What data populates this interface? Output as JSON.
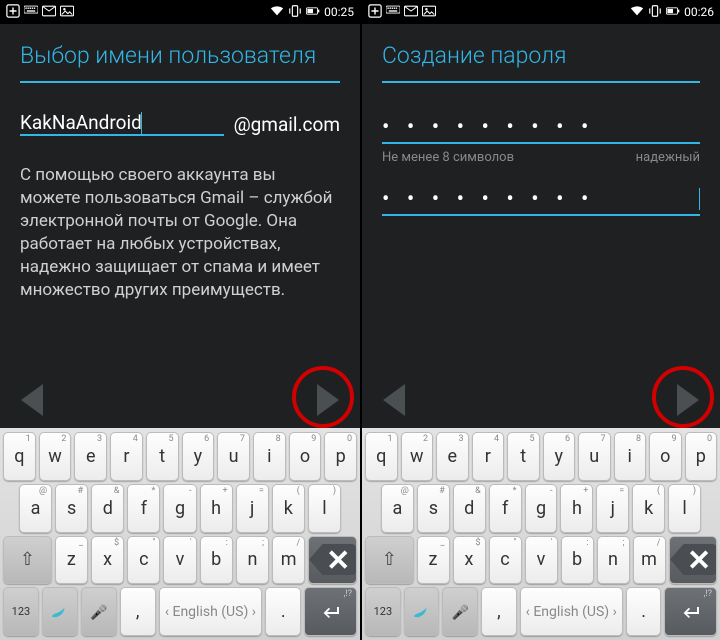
{
  "panes": [
    {
      "status": {
        "time": "00:25"
      },
      "title": "Выбор имени пользователя",
      "username": "KakNaAndroid",
      "suffix": "@gmail.com",
      "desc": "С помощью своего аккаунта вы можете пользоваться Gmail – службой электронной почты от Google. Она работает на любых устройствах, надежно защищает от спама и имеет множество других преимуществ."
    },
    {
      "status": {
        "time": "00:26"
      },
      "title": "Создание пароля",
      "pwd1_dots": "• • • • • • • • •",
      "hint": "Не менее 8 символов",
      "strength": "надежный",
      "pwd2_dots": "• • • • • • • • •"
    }
  ],
  "keyboard": {
    "row1": [
      {
        "m": "q",
        "s": "1"
      },
      {
        "m": "w",
        "s": "2"
      },
      {
        "m": "e",
        "s": "3"
      },
      {
        "m": "r",
        "s": "4"
      },
      {
        "m": "t",
        "s": "5"
      },
      {
        "m": "y",
        "s": "6"
      },
      {
        "m": "u",
        "s": "7"
      },
      {
        "m": "i",
        "s": "8"
      },
      {
        "m": "o",
        "s": "9"
      },
      {
        "m": "p",
        "s": "0"
      }
    ],
    "row2": [
      {
        "m": "a",
        "s": "@"
      },
      {
        "m": "s",
        "s": "#"
      },
      {
        "m": "d",
        "s": "&"
      },
      {
        "m": "f",
        "s": "*"
      },
      {
        "m": "g",
        "s": "-"
      },
      {
        "m": "h",
        "s": "+"
      },
      {
        "m": "j",
        "s": "="
      },
      {
        "m": "k",
        "s": "("
      },
      {
        "m": "l",
        "s": ")"
      }
    ],
    "row3": [
      {
        "m": "z",
        "s": "_"
      },
      {
        "m": "x",
        "s": "$"
      },
      {
        "m": "c",
        "s": "\""
      },
      {
        "m": "v",
        "s": "'"
      },
      {
        "m": "b",
        "s": ":"
      },
      {
        "m": "n",
        "s": ";"
      },
      {
        "m": "m",
        "s": "/"
      }
    ],
    "bottom": {
      "numkey": "123",
      "lang": "English (US)",
      "comma": ",",
      "period": ".",
      "enter_sup": ",!?"
    }
  }
}
